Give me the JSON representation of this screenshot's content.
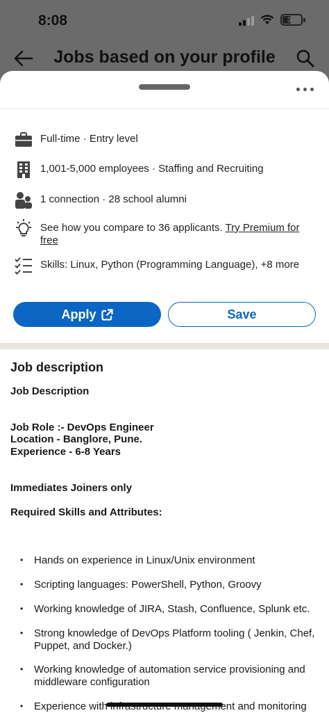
{
  "status_bar": {
    "time": "8:08",
    "battery": "35"
  },
  "header": {
    "title": "Jobs based on your profile"
  },
  "job_info": {
    "type": "Full-time · Entry level",
    "company": "1,001-5,000 employees · Staffing and Recruiting",
    "connections": "1 connection · 28 school alumni",
    "compare_text": "See how you compare to 36 applicants. ",
    "premium_link_1": "Try Premium for",
    "premium_link_2": "free",
    "skills": "Skills: Linux, Python (Programming Language), +8 more"
  },
  "actions": {
    "apply_label": "Apply",
    "save_label": "Save"
  },
  "description": {
    "heading": "Job description",
    "subheading": "Job Description",
    "role": "Job Role :- DevOps Engineer",
    "location": "Location - Banglore, Pune.",
    "experience": "Experience - 6-8 Years",
    "joiners": "Immediates Joiners only",
    "skills_heading": "Required Skills and Attributes:",
    "bullets": [
      "Hands on experience in Linux/Unix environment",
      "Scripting languages: PowerShell, Python, Groovy",
      "Working knowledge of JIRA, Stash, Confluence, Splunk etc.",
      "Strong knowledge of DevOps Platform tooling ( Jenkin, Chef, Puppet, and Docker.)",
      "Working knowledge of automation service provisioning and middleware configuration",
      "Experience with infrastructure management and monitoring"
    ]
  },
  "colors": {
    "accent": "#0a66c2",
    "separator": "#eae6df"
  },
  "icons": [
    "back-arrow-icon",
    "search-icon",
    "more-icon",
    "briefcase-icon",
    "building-icon",
    "people-icon",
    "lightbulb-icon",
    "checklist-icon",
    "external-link-icon"
  ]
}
